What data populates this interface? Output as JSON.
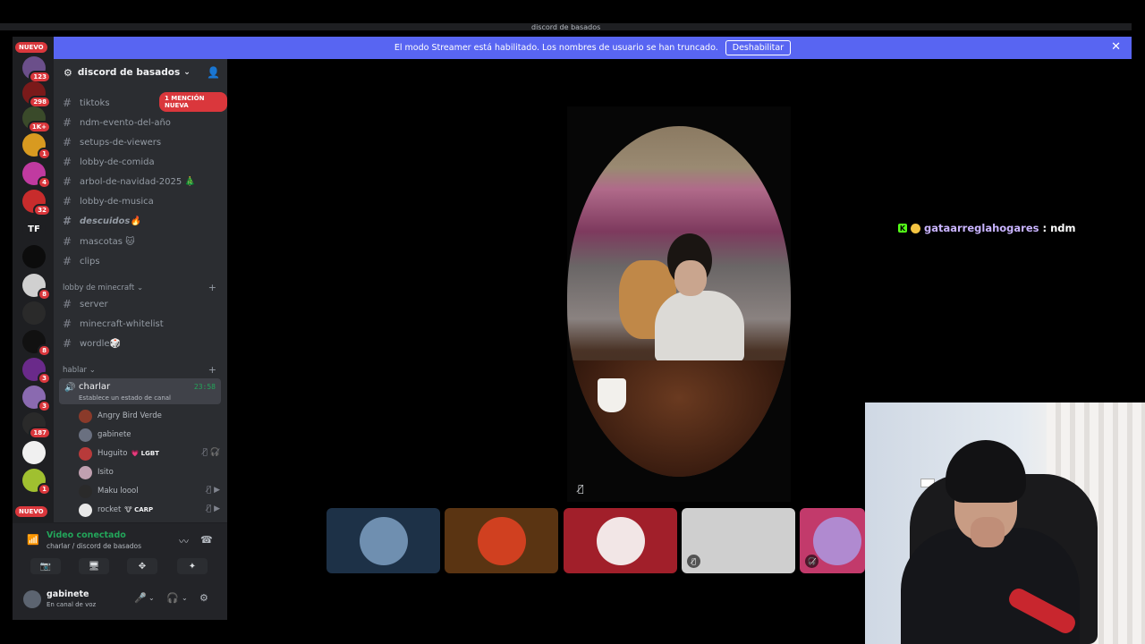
{
  "window": {
    "title": "discord de basados"
  },
  "banner": {
    "text": "El modo Streamer está habilitado. Los nombres de usuario se han truncado.",
    "button": "Deshabilitar",
    "close_icon": "close-icon"
  },
  "rail": {
    "new_top": "NUEVO",
    "new_bottom": "NUEVO",
    "tf_label": "TF",
    "badges": [
      "123",
      "298",
      "1K+",
      "1",
      "4",
      "32",
      "8",
      "8",
      "3",
      "3",
      "187",
      "1"
    ]
  },
  "guild": {
    "name": "discord de basados"
  },
  "mention_pill": "1 MENCIÓN NUEVA",
  "channels": [
    {
      "name": "tiktoks"
    },
    {
      "name": "ndm-evento-del-año"
    },
    {
      "name": "setups-de-viewers"
    },
    {
      "name": "lobby-de-comida"
    },
    {
      "name": "arbol-de-navidad-2025 🎄"
    },
    {
      "name": "lobby-de-musica"
    },
    {
      "name": "descuidos🔥"
    },
    {
      "name": "mascotas 🐱"
    },
    {
      "name": "clips"
    }
  ],
  "category_minecraft": {
    "name": "lobby de minecraft",
    "channels": [
      {
        "name": "server"
      },
      {
        "name": "minecraft-whitelist"
      },
      {
        "name": "wordle🎲"
      }
    ]
  },
  "category_voice": {
    "name": "hablar"
  },
  "voice_channel": {
    "name": "charlar",
    "status": "Establece un estado de canal",
    "time": "23:58",
    "users": [
      {
        "name": "Angry Bird Verde",
        "tag": "",
        "color": "#8a3a2a"
      },
      {
        "name": "gabinete",
        "tag": "",
        "color": "#6a7080"
      },
      {
        "name": "Huguito",
        "tag": "💗 LGBT",
        "color": "#b83a3a"
      },
      {
        "name": "Isito",
        "tag": "",
        "color": "#c0a0b0"
      },
      {
        "name": "Maku loool",
        "tag": "",
        "color": "#2a2a2a"
      },
      {
        "name": "rocket",
        "tag": "🐮 CARP",
        "color": "#e8e8e8"
      }
    ]
  },
  "voice_connected": {
    "status": "Video conectado",
    "sub": "charlar / discord de basados"
  },
  "user": {
    "name": "gabinete",
    "status": "En canal de voz"
  },
  "chat": {
    "user": "gataarreglahogares",
    "message": "ndm",
    "separator": ":"
  },
  "tiles": [
    {
      "name": "tile-1",
      "bg": "#1d3147",
      "av": "#6f8fb0"
    },
    {
      "name": "tile-2",
      "bg": "#5a3412",
      "av": "#d04020"
    },
    {
      "name": "tile-3",
      "bg": "#a11f2a",
      "av": "#f2e6e6"
    },
    {
      "name": "tile-4",
      "bg": "#cfcfcf",
      "av": ""
    },
    {
      "name": "tile-5",
      "bg": "#c23a6b",
      "av": "#b08ad0"
    }
  ],
  "colors": {
    "accent": "#5865f2",
    "green": "#23a55a",
    "red": "#da373c"
  }
}
